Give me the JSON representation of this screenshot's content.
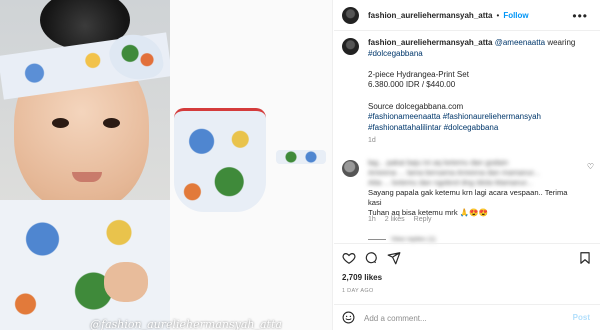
{
  "post": {
    "username": "fashion_aureliehermansyah_atta",
    "follow_label": "Follow",
    "header_separator": "•",
    "watermark": "@fashion_aureliehermansyah_atta"
  },
  "caption": {
    "username": "fashion_aureliehermansyah_atta",
    "mention": "@ameenaatta",
    "after_mention": " wearing",
    "hashtag1": "#dolcegabbana",
    "product_name": "2-piece Hydrangea-Print Set",
    "price": "6.380.000 IDR / $440.00",
    "source": "Source dolcegabbana.com",
    "tags_line1": "#fashionameenaatta #fashionaureliehermansyah",
    "tags_line2": "#fashionattahalilintar #dolcegabbana",
    "age": "1d"
  },
  "comment": {
    "text_line1": "lag... pakai baju ini aq ketemu dan godain",
    "text_line2": "Ameena ... lama bersama Ameena dan mamanur...",
    "text_line3": "Atta ... ketemu dan ngobrol dng Idola Mamanur...",
    "text_line4": "Sayang papala gak ketemu krn lagi acara vespaan.. Terima kasi",
    "text_line5": "Tuhan aq bisa ketemu mrk 🙏😍😍",
    "age": "1h",
    "likes": "2 likes",
    "reply_label": "Reply",
    "view_replies": "View replies (1)"
  },
  "stats": {
    "likes": "2,709 likes",
    "posted_ago": "1 DAY AGO"
  },
  "add_comment": {
    "placeholder": "Add a comment...",
    "post_label": "Post"
  },
  "icons": {
    "more": "more-icon",
    "heart": "heart-icon",
    "comment": "comment-icon",
    "share": "share-icon",
    "save": "bookmark-icon",
    "emoji": "emoji-icon"
  },
  "colors": {
    "accent": "#0095f6",
    "link": "#00376b",
    "muted": "#8e8e8e",
    "post_disabled": "#b2dffc"
  }
}
